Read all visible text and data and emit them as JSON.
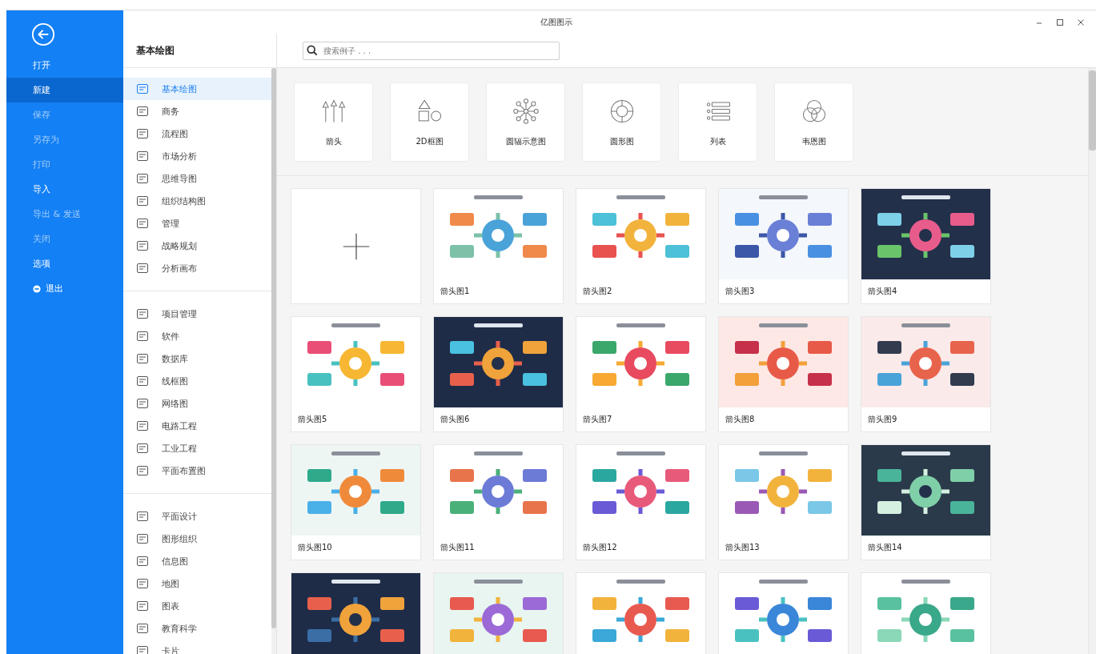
{
  "window": {
    "title": "亿图图示"
  },
  "sidebar": {
    "items": [
      {
        "label": "打开",
        "selected": false,
        "disabled": false,
        "kind": "text"
      },
      {
        "label": "新建",
        "selected": true,
        "disabled": false,
        "kind": "text"
      },
      {
        "label": "保存",
        "selected": false,
        "disabled": true,
        "kind": "text"
      },
      {
        "label": "另存为",
        "selected": false,
        "disabled": true,
        "kind": "text"
      },
      {
        "label": "打印",
        "selected": false,
        "disabled": true,
        "kind": "text"
      },
      {
        "label": "导入",
        "selected": false,
        "disabled": false,
        "kind": "text"
      },
      {
        "label": "导出 & 发送",
        "selected": false,
        "disabled": true,
        "kind": "text"
      },
      {
        "label": "关闭",
        "selected": false,
        "disabled": true,
        "kind": "text"
      },
      {
        "label": "选项",
        "selected": false,
        "disabled": false,
        "kind": "text"
      },
      {
        "label": "退出",
        "selected": false,
        "disabled": false,
        "kind": "exit"
      }
    ]
  },
  "categories": {
    "title": "基本绘图",
    "groups": [
      {
        "items": [
          {
            "label": "基本绘图",
            "selected": true
          },
          {
            "label": "商务",
            "selected": false
          },
          {
            "label": "流程图",
            "selected": false
          },
          {
            "label": "市场分析",
            "selected": false
          },
          {
            "label": "思维导图",
            "selected": false
          },
          {
            "label": "组织结构图",
            "selected": false
          },
          {
            "label": "管理",
            "selected": false
          },
          {
            "label": "战略规划",
            "selected": false
          },
          {
            "label": "分析画布",
            "selected": false
          }
        ]
      },
      {
        "items": [
          {
            "label": "项目管理",
            "selected": false
          },
          {
            "label": "软件",
            "selected": false
          },
          {
            "label": "数据库",
            "selected": false
          },
          {
            "label": "线框图",
            "selected": false
          },
          {
            "label": "网络图",
            "selected": false
          },
          {
            "label": "电路工程",
            "selected": false
          },
          {
            "label": "工业工程",
            "selected": false
          },
          {
            "label": "平面布置图",
            "selected": false
          }
        ]
      },
      {
        "items": [
          {
            "label": "平面设计",
            "selected": false
          },
          {
            "label": "图形组织",
            "selected": false
          },
          {
            "label": "信息图",
            "selected": false
          },
          {
            "label": "地图",
            "selected": false
          },
          {
            "label": "图表",
            "selected": false
          },
          {
            "label": "教育科学",
            "selected": false
          },
          {
            "label": "卡片",
            "selected": false
          }
        ]
      }
    ]
  },
  "search": {
    "placeholder": "搜索例子 . . ."
  },
  "gallery": [
    {
      "label": "箭头"
    },
    {
      "label": "2D框图"
    },
    {
      "label": "圆辐示意图"
    },
    {
      "label": "圆形图"
    },
    {
      "label": "列表"
    },
    {
      "label": "韦恩图"
    }
  ],
  "templates": [
    {
      "kind": "new"
    },
    {
      "kind": "template",
      "label": "箭头图1"
    },
    {
      "kind": "template",
      "label": "箭头图2"
    },
    {
      "kind": "template",
      "label": "箭头图3"
    },
    {
      "kind": "template",
      "label": "箭头图4"
    },
    {
      "kind": "template",
      "label": "箭头图5"
    },
    {
      "kind": "template",
      "label": "箭头图6"
    },
    {
      "kind": "template",
      "label": "箭头图7"
    },
    {
      "kind": "template",
      "label": "箭头图8"
    },
    {
      "kind": "template",
      "label": "箭头图9"
    },
    {
      "kind": "template",
      "label": "箭头图10"
    },
    {
      "kind": "template",
      "label": "箭头图11"
    },
    {
      "kind": "template",
      "label": "箭头图12"
    },
    {
      "kind": "template",
      "label": "箭头图13"
    },
    {
      "kind": "template",
      "label": "箭头图14"
    },
    {
      "kind": "picture"
    },
    {
      "kind": "picture"
    },
    {
      "kind": "picture"
    },
    {
      "kind": "picture"
    },
    {
      "kind": "picture"
    }
  ]
}
